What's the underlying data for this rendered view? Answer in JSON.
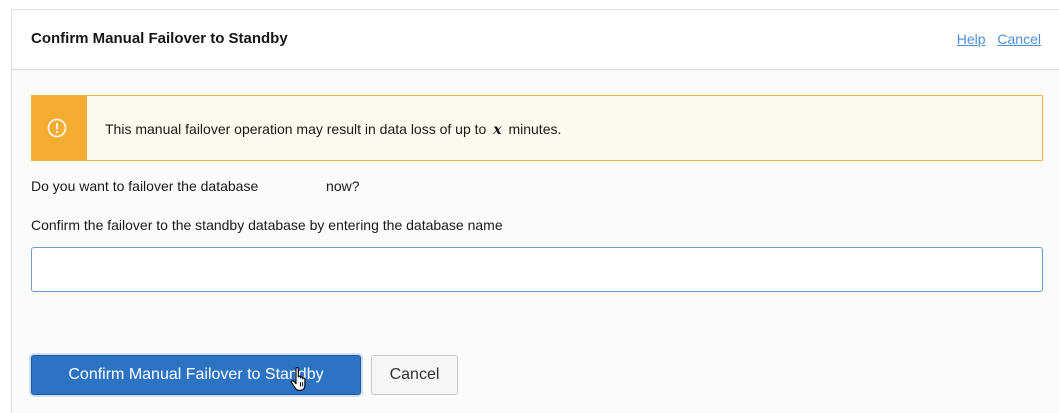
{
  "dialog": {
    "title": "Confirm Manual Failover to Standby",
    "help_link": "Help",
    "cancel_link": "Cancel"
  },
  "warning": {
    "icon": "warning-circle-icon",
    "text_before": "This manual failover operation may result in data loss of up to",
    "variable": "x",
    "text_after": "minutes.",
    "accent_color": "#f4ad31"
  },
  "question": {
    "before": "Do you want to failover the database",
    "after": "now?"
  },
  "confirm": {
    "label": "Confirm the failover to the standby database by entering the database name",
    "input_value": ""
  },
  "buttons": {
    "primary": "Confirm Manual Failover to Standby",
    "secondary": "Cancel"
  },
  "colors": {
    "primary_button": "#2c74c3",
    "link": "#4f8fd6"
  }
}
